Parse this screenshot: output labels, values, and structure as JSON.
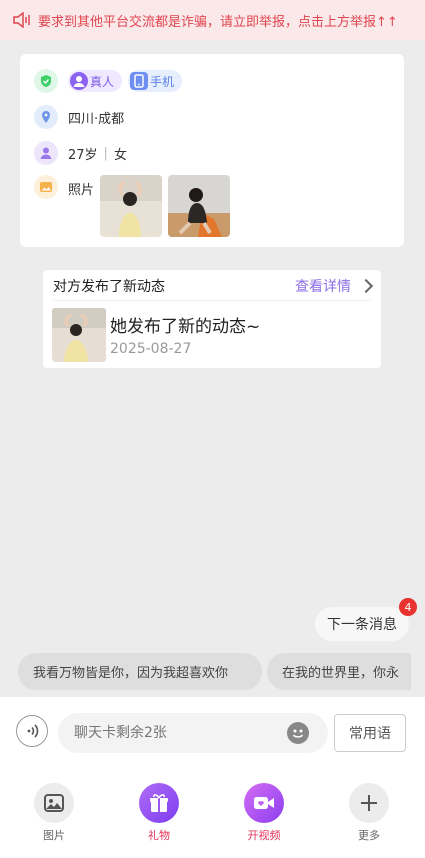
{
  "warning": {
    "text": "要求到其他平台交流都是诈骗，请立即举报，点击上方举报↑↑"
  },
  "profile": {
    "badges": [
      "真人",
      "手机"
    ],
    "location": "四川·成都",
    "age": "27岁",
    "separator": "|",
    "gender": "女",
    "photos_label": "照片"
  },
  "feed": {
    "header": "对方发布了新动态",
    "link": "查看详情",
    "title": "她发布了新的动态~",
    "date": "2025-08-27"
  },
  "next_message": {
    "label": "下一条消息",
    "badge": "4"
  },
  "phrases": [
    "我看万物皆是你，因为我超喜欢你",
    "在我的世界里，你永"
  ],
  "composer": {
    "placeholder": "聊天卡剩余2张",
    "quick_label": "常用语"
  },
  "toolbar": {
    "items": [
      {
        "label": "图片",
        "color": "#666666"
      },
      {
        "label": "礼物",
        "color": "#e5345a"
      },
      {
        "label": "开视频",
        "color": "#e5345a"
      },
      {
        "label": "更多",
        "color": "#666666"
      }
    ]
  },
  "colors": {
    "accent": "#8c6ee8",
    "warn": "#e0454f",
    "badge": "#e8332e"
  }
}
